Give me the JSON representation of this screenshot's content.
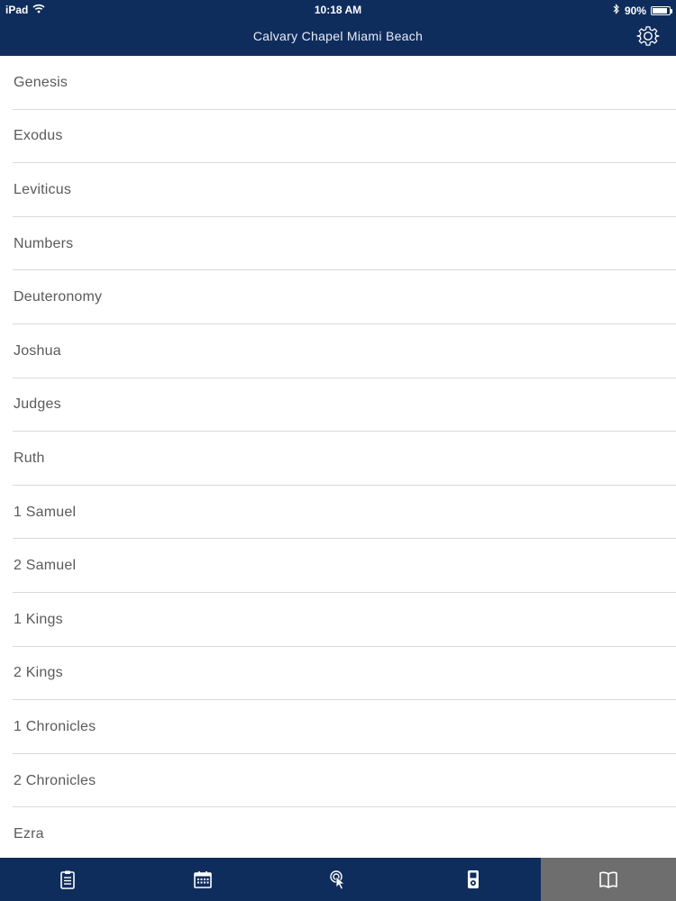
{
  "status_bar": {
    "device": "iPad",
    "time": "10:18 AM",
    "battery_text": "90%",
    "battery_level": 0.9
  },
  "nav": {
    "title": "Calvary Chapel Miami Beach"
  },
  "books": [
    {
      "label": "Genesis"
    },
    {
      "label": "Exodus"
    },
    {
      "label": "Leviticus"
    },
    {
      "label": "Numbers"
    },
    {
      "label": "Deuteronomy"
    },
    {
      "label": "Joshua"
    },
    {
      "label": "Judges"
    },
    {
      "label": "Ruth"
    },
    {
      "label": "1 Samuel"
    },
    {
      "label": "2 Samuel"
    },
    {
      "label": "1 Kings"
    },
    {
      "label": "2 Kings"
    },
    {
      "label": "1 Chronicles"
    },
    {
      "label": "2 Chronicles"
    },
    {
      "label": "Ezra"
    }
  ],
  "tabs": [
    {
      "icon": "clipboard-icon",
      "active": false
    },
    {
      "icon": "calendar-icon",
      "active": false
    },
    {
      "icon": "touch-pointer-icon",
      "active": false
    },
    {
      "icon": "media-player-icon",
      "active": false
    },
    {
      "icon": "open-book-icon",
      "active": true
    }
  ],
  "colors": {
    "navbar_bg": "#0f2d5c",
    "active_tab_bg": "#6e6e6e",
    "list_text": "#5a5a5a",
    "divider": "#d9d9d9"
  }
}
